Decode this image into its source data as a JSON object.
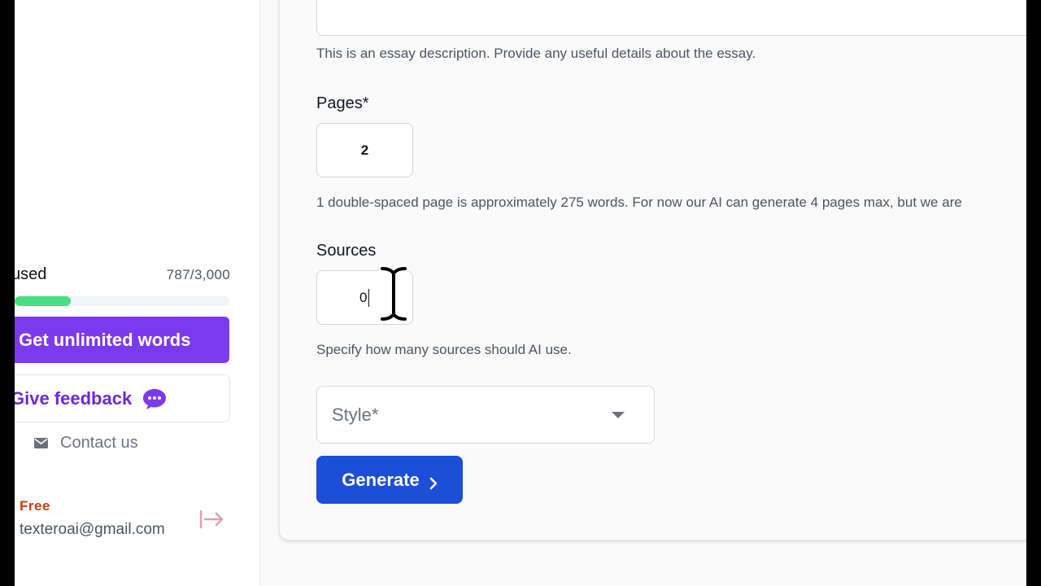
{
  "sidebar": {
    "usage_label": "used",
    "usage_count": "787/3,000",
    "usage_fraction": 0.2623,
    "upgrade_label": "Get unlimited words",
    "feedback_label": "Give feedback",
    "contact_label": "Contact us",
    "plan_label": "Free",
    "email": "texteroai@gmail.com"
  },
  "form": {
    "description_value": "",
    "description_helper": "This is an essay description. Provide any useful details about the essay.",
    "pages_label": "Pages*",
    "pages_value": "2",
    "pages_helper": "1 double-spaced page is approximately 275 words. For now our AI can generate 4 pages max, but we are",
    "sources_label": "Sources",
    "sources_value": "0",
    "sources_helper": "Specify how many sources should AI use.",
    "style_placeholder": "Style*",
    "generate_label": "Generate"
  },
  "colors": {
    "accent_purple": "#7c3aed",
    "primary_blue": "#1d4ed8",
    "progress_green": "#4ade80",
    "plan_orange": "#c2410c"
  },
  "icons": [
    "chat-bubble-icon",
    "mail-icon",
    "logout-icon",
    "dropdown-caret-icon",
    "chevron-right-icon",
    "text-cursor-icon"
  ]
}
